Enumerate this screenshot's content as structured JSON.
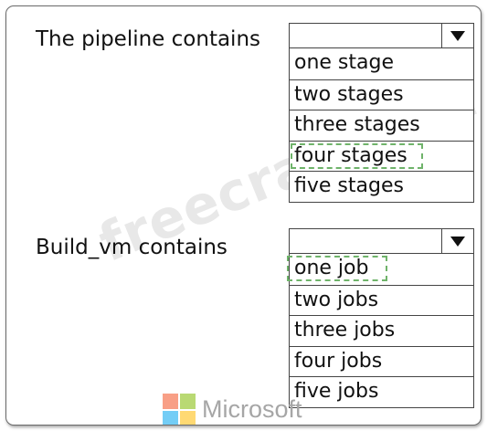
{
  "watermark": "freecram.net",
  "questions": [
    {
      "label": "The pipeline contains",
      "selected": "four stages",
      "options": [
        "one stage",
        "two stages",
        "three stages",
        "four stages",
        "five stages"
      ]
    },
    {
      "label": "Build_vm contains",
      "selected": "one job",
      "options": [
        "one job",
        "two jobs",
        "three jobs",
        "four jobs",
        "five jobs"
      ]
    }
  ],
  "logo": {
    "text": "Microsoft",
    "colors": [
      "#f25022",
      "#7fba00",
      "#00a4ef",
      "#ffb900"
    ]
  },
  "accent": {
    "selection_dash": "#6fb36a"
  }
}
